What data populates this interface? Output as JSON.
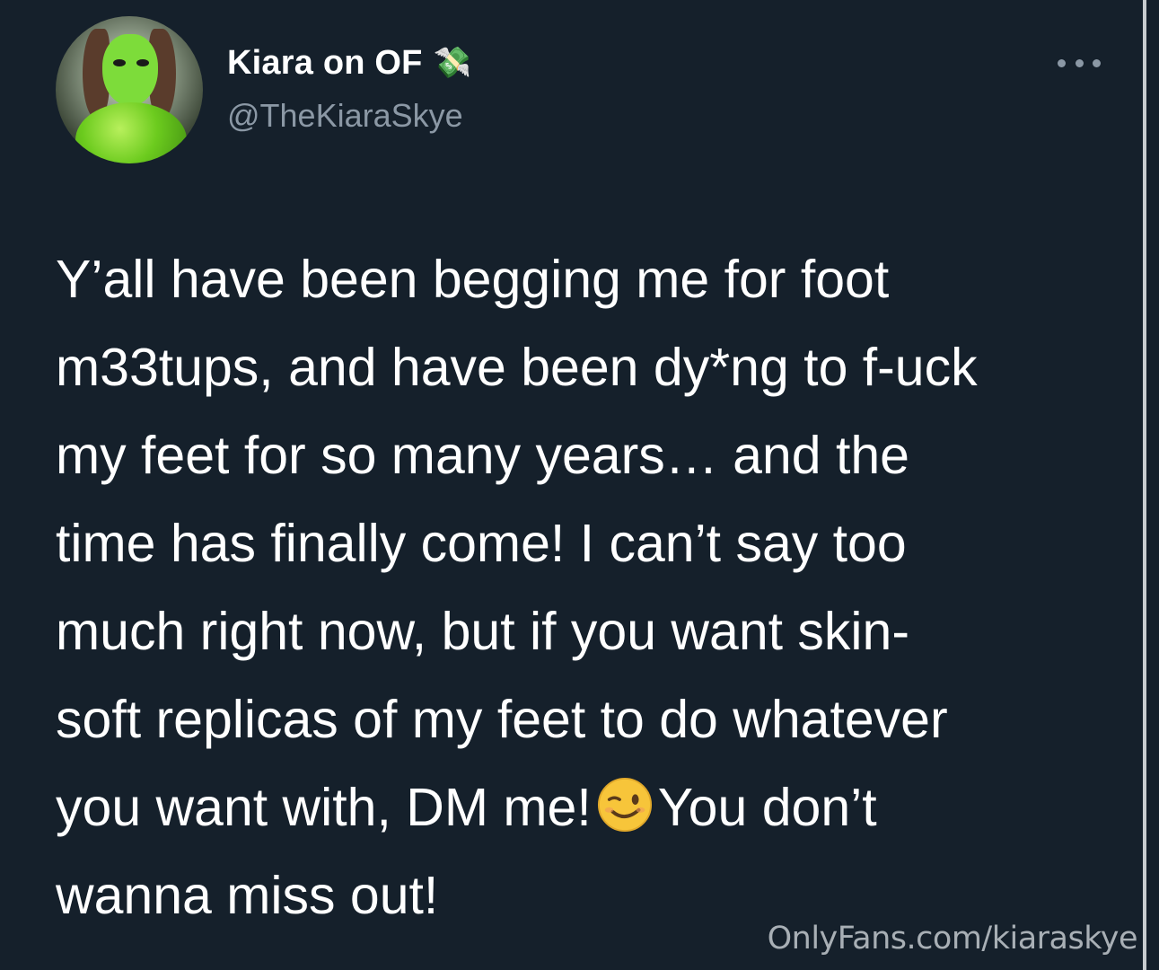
{
  "author": {
    "display_name": "Kiara on OF",
    "name_emoji": "💸",
    "handle": "@TheKiaraSkye",
    "avatar_icon": "avatar-photo"
  },
  "menu": {
    "more_icon": "more-horizontal-icon"
  },
  "tweet": {
    "lines": [
      "Y’all have been begging me for foot",
      "m33tups, and have been dy*ng to f-uck",
      "my feet for so many years… and the",
      "time has finally come! I can’t say too",
      "much right now, but if you want skin-",
      "soft replicas of my feet to do whatever"
    ],
    "line7_before_emoji": "you want with, DM me!",
    "line7_after_emoji": "You don’t",
    "line8": "wanna miss out!",
    "emoji_name": "winking-face-icon"
  },
  "watermark": {
    "text": "OnlyFans.com/kiaraskye"
  },
  "colors": {
    "background": "#15202b",
    "text": "#ffffff",
    "secondary_text": "#8b98a5",
    "scrollbar": "#c8ccd0"
  }
}
